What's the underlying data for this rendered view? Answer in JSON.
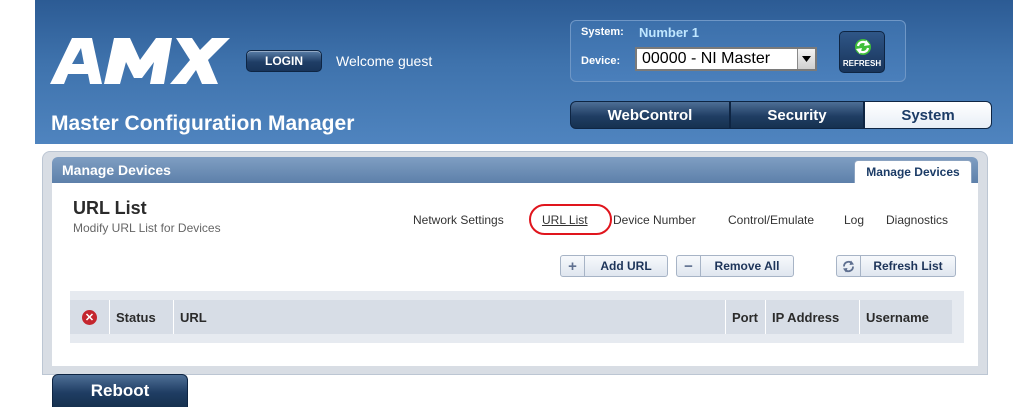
{
  "header": {
    "logo_text": "AMX",
    "login_label": "LOGIN",
    "welcome_text": "Welcome guest",
    "app_title": "Master Configuration Manager",
    "system_label": "System:",
    "system_value": "Number 1",
    "device_label": "Device:",
    "device_selected": "00000 - NI Master",
    "refresh_label": "REFRESH"
  },
  "nav": {
    "tabs": [
      {
        "label": "WebControl",
        "active": false
      },
      {
        "label": "Security",
        "active": false
      },
      {
        "label": "System",
        "active": true
      }
    ]
  },
  "panel": {
    "header_title": "Manage Devices",
    "header_tab": "Manage Devices",
    "page_title": "URL List",
    "page_subtitle": "Modify URL List for Devices",
    "subnav": [
      {
        "label": "Network Settings",
        "current": false
      },
      {
        "label": "URL List",
        "current": true
      },
      {
        "label": "Device Number",
        "current": false
      },
      {
        "label": "Control/Emulate",
        "current": false
      },
      {
        "label": "Log",
        "current": false
      },
      {
        "label": "Diagnostics",
        "current": false
      }
    ],
    "actions": {
      "add_url": "Add URL",
      "remove_all": "Remove All",
      "refresh_list": "Refresh List"
    },
    "table": {
      "columns": [
        "Status",
        "URL",
        "Port",
        "IP Address",
        "Username"
      ],
      "rows": []
    }
  },
  "footer": {
    "reboot_label": "Reboot"
  },
  "colors": {
    "header_blue": "#3f73ad",
    "nav_dark": "#1f3d63",
    "highlight_red": "#e0151d",
    "delete_red": "#c4262e"
  }
}
